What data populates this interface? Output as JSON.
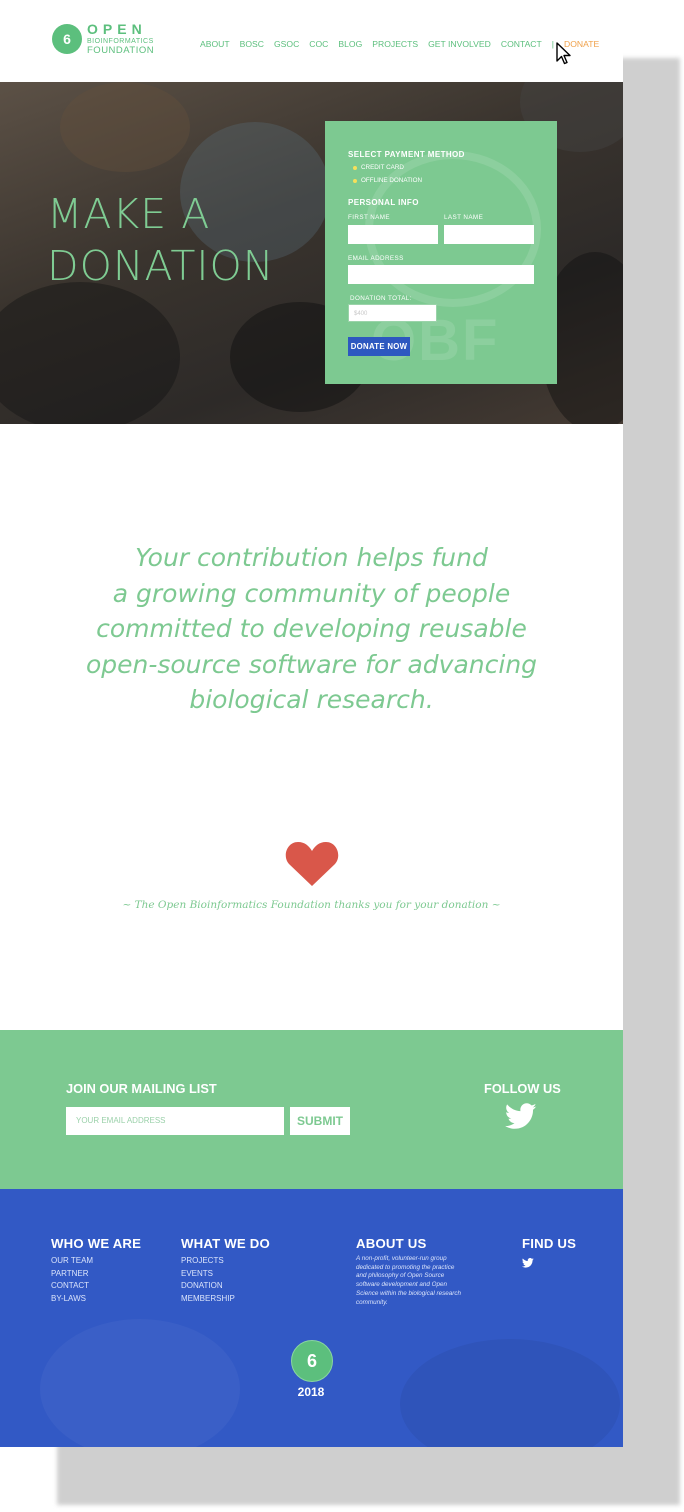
{
  "header": {
    "logo": {
      "line1": "OPEN",
      "line2": "BIOINFORMATICS",
      "line3": "FOUNDATION",
      "mark": "6"
    },
    "nav": [
      {
        "label": "ABOUT"
      },
      {
        "label": "BOSC"
      },
      {
        "label": "GSOC"
      },
      {
        "label": "COC"
      },
      {
        "label": "BLOG"
      },
      {
        "label": "PROJECTS"
      },
      {
        "label": "GET INVOLVED"
      },
      {
        "label": "CONTACT"
      }
    ],
    "separator": "|",
    "donate": "DONATE"
  },
  "hero": {
    "title_line1": "MAKE A",
    "title_line2": "DONATION",
    "form": {
      "payment_heading": "SELECT PAYMENT METHOD",
      "payment_options": [
        "CREDIT CARD",
        "OFFLINE DONATION"
      ],
      "personal_heading": "PERSONAL INFO",
      "first_name_label": "FIRST NAME",
      "last_name_label": "LAST NAME",
      "email_label": "EMAIL ADDRESS",
      "total_label": "DONATION TOTAL:",
      "total_value": "$400",
      "submit": "DONATE NOW",
      "watermark": "OBF"
    }
  },
  "message": {
    "quote_lines": [
      "Your contribution helps fund",
      "a growing community of people",
      "committed to developing reusable",
      "open-source software for advancing",
      "biological research."
    ],
    "thanks": "~ The Open Bioinformatics Foundation thanks you for your donation ~"
  },
  "mailing": {
    "heading": "JOIN OUR MAILING LIST",
    "placeholder": "YOUR EMAIL ADDRESS",
    "submit": "SUBMIT",
    "follow": "FOLLOW US"
  },
  "footer": {
    "who": {
      "heading": "WHO WE ARE",
      "items": [
        "OUR TEAM",
        "PARTNER",
        "CONTACT",
        "BY-LAWS"
      ]
    },
    "what": {
      "heading": "WHAT WE DO",
      "items": [
        "PROJECTS",
        "EVENTS",
        "DONATION",
        "MEMBERSHIP"
      ]
    },
    "about": {
      "heading": "ABOUT US",
      "text": "A non-profit, volunteer-run group dedicated to promoting the practice and philosophy of Open Source software development and Open Science within the biological research community."
    },
    "find": {
      "heading": "FIND US"
    },
    "logo_mark": "6",
    "year": "2018"
  },
  "colors": {
    "green": "#7dc991",
    "blue": "#3259c5",
    "accent": "#f0a14a",
    "heart": "#d9574a"
  }
}
